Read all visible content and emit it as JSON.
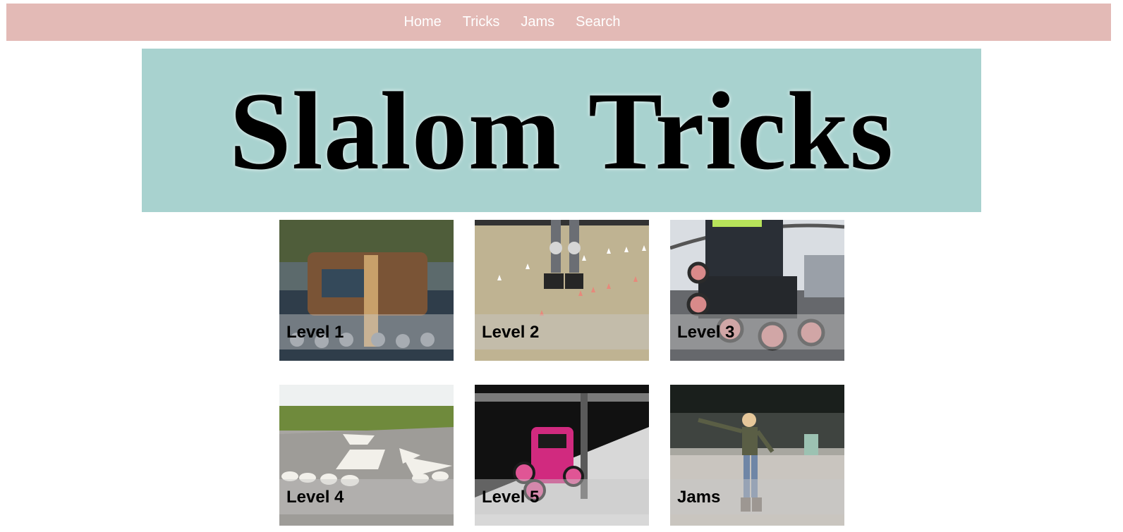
{
  "nav": {
    "items": [
      {
        "label": "Home"
      },
      {
        "label": "Tricks"
      },
      {
        "label": "Jams"
      },
      {
        "label": "Search"
      }
    ]
  },
  "banner": {
    "title": "Slalom Tricks"
  },
  "tiles": [
    {
      "label": "Level 1",
      "photo": "inline-skates-on-steps"
    },
    {
      "label": "Level 2",
      "photo": "skater-among-cones"
    },
    {
      "label": "Level 3",
      "photo": "skate-wheels-closeup"
    },
    {
      "label": "Level 4",
      "photo": "road-markings"
    },
    {
      "label": "Level 5",
      "photo": "pink-skates-on-rail"
    },
    {
      "label": "Jams",
      "photo": "woman-skating"
    }
  ],
  "colors": {
    "nav_bg": "#e3bab6",
    "banner_bg": "#a8d2cf"
  }
}
